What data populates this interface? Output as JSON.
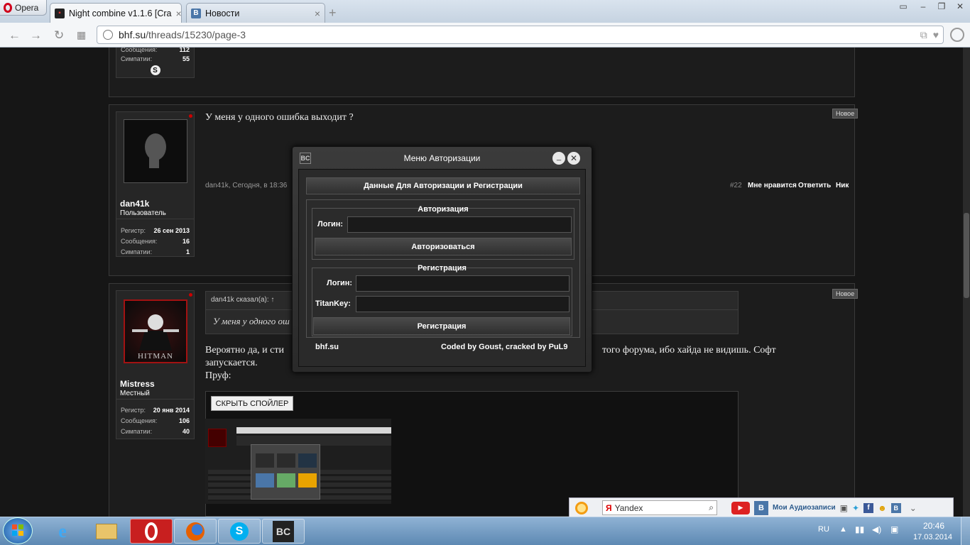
{
  "browser": {
    "menu_label": "Opera",
    "tabs": [
      {
        "title": "Night combine v1.1.6 [Cra",
        "favicon": "bhf-icon"
      },
      {
        "title": "Новости",
        "favicon": "vk-icon"
      }
    ],
    "url_host": "bhf.su",
    "url_path": "/threads/15230/page-3"
  },
  "posts": [
    {
      "stats": [
        {
          "label": "Сообщения:",
          "value": "112"
        },
        {
          "label": "Симпатии:",
          "value": "55"
        }
      ]
    },
    {
      "username": "dan41k",
      "user_title": "Пользователь",
      "stats": [
        {
          "label": "Регистр:",
          "value": "26 сен 2013"
        },
        {
          "label": "Сообщения:",
          "value": "16"
        },
        {
          "label": "Симпатии:",
          "value": "1"
        }
      ],
      "text": "У меня у одного ошибка выходит ?",
      "meta": "dan41k, Сегодня, в 18:36",
      "number": "#22",
      "actions": [
        "Мне нравится",
        "Ответить",
        "Ник"
      ],
      "badge": "Новое"
    },
    {
      "username": "Mistress",
      "user_title": "Местный",
      "stats": [
        {
          "label": "Регистр:",
          "value": "20 янв 2014"
        },
        {
          "label": "Сообщения:",
          "value": "106"
        },
        {
          "label": "Симпатии:",
          "value": "40"
        }
      ],
      "quote_author": "dan41k сказал(а): ↑",
      "quote_text": "У меня у одного ош",
      "text_part1": "Вероятно да, и сти",
      "text_part2": "того форума, ибо хайда не видишь. Софт",
      "text_line2": "запускается.",
      "text_line3": "Пруф:",
      "spoiler_button": "СКРЫТЬ СПОЙЛЕР",
      "badge": "Новое",
      "avatar_text": "HITMAN"
    }
  ],
  "modal": {
    "logo": "BC",
    "title": "Меню Авторизации",
    "header_button": "Данные Для Авторизации и Регистрации",
    "auth": {
      "title": "Авторизация",
      "login_label": "Логин:",
      "button": "Авторизоваться"
    },
    "register": {
      "title": "Регистрация",
      "login_label": "Логин:",
      "key_label": "TitanKey:",
      "button": "Регистрация"
    },
    "footer_left": "bhf.su",
    "footer_right": "Coded by Goust, cracked by PuL9"
  },
  "yandex_bar": {
    "search_text": "Yandex",
    "audio_label": "Мои Аудиозаписи"
  },
  "taskbar": {
    "lang": "RU",
    "time": "20:46",
    "date": "17.03.2014",
    "pinned": [
      "ie-icon",
      "explorer-icon",
      "opera-icon",
      "firefox-icon",
      "skype-icon",
      "bc-icon"
    ]
  },
  "colors": {
    "accent_red": "#d0011b",
    "vk_blue": "#4a76a8",
    "taskbar": "#5d89b3"
  }
}
